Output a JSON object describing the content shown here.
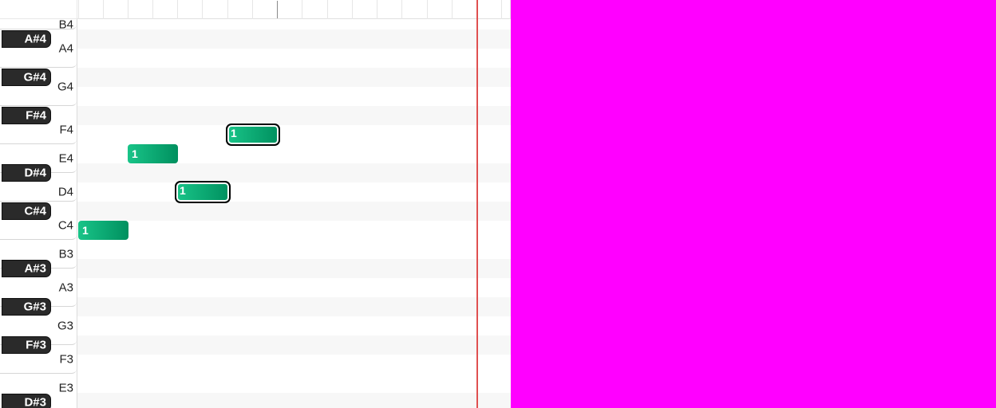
{
  "piano_roll": {
    "white_keys": [
      "B4",
      "A4",
      "G4",
      "F4",
      "E4",
      "D4",
      "C4",
      "B3",
      "A3",
      "G3",
      "F3",
      "E3"
    ],
    "black_keys": [
      "A#4",
      "G#4",
      "F#4",
      "D#4",
      "C#4",
      "A#3",
      "G#3",
      "F#3",
      "D#3"
    ],
    "notes": [
      {
        "pitch": "F4",
        "label": "1",
        "selected": true
      },
      {
        "pitch": "E4",
        "label": "1",
        "selected": false
      },
      {
        "pitch": "D4",
        "label": "1",
        "selected": true
      },
      {
        "pitch": "C4",
        "label": "1",
        "selected": false
      }
    ]
  },
  "colors": {
    "note": "#00a070",
    "playhead": "#e05050",
    "background": "#ff00ff"
  }
}
